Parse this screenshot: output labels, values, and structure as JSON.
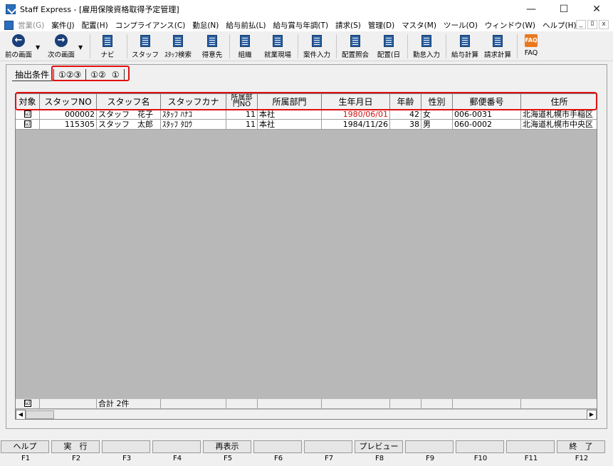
{
  "window": {
    "title": "Staff Express - [雇用保険資格取得予定管理]",
    "controls": [
      "—",
      "☐",
      "✕"
    ]
  },
  "menubar": {
    "items": [
      {
        "label": "営業(G)",
        "disabled": true
      },
      {
        "label": "案件(J)"
      },
      {
        "label": "配置(H)"
      },
      {
        "label": "コンプライアンス(C)"
      },
      {
        "label": "勤怠(N)"
      },
      {
        "label": "給与前払(L)"
      },
      {
        "label": "給与賞与年調(T)"
      },
      {
        "label": "請求(S)"
      },
      {
        "label": "管理(D)"
      },
      {
        "label": "マスタ(M)"
      },
      {
        "label": "ツール(O)"
      },
      {
        "label": "ウィンドウ(W)"
      },
      {
        "label": "ヘルプ(H)"
      }
    ],
    "mdi_controls": [
      "_",
      "ﾛ",
      "x"
    ]
  },
  "toolbar": {
    "prev": "前の画面",
    "next": "次の画面",
    "navi": "ナビ",
    "staff": "スタッフ",
    "staff_search": "ｽﾀｯﾌ検索",
    "client": "得意先",
    "org": "組織",
    "worksite": "就業現場",
    "case_input": "案件入力",
    "assign_inquiry": "配置照会",
    "assign_day": "配置(日",
    "attendance_input": "勤怠入力",
    "payroll_calc": "給与計算",
    "billing_calc": "請求計算",
    "faq": "FAQ",
    "faq_icon_text": "FAQ"
  },
  "tabs": {
    "items": [
      "抽出条件",
      "①②③",
      "①②",
      "①"
    ]
  },
  "grid": {
    "columns": [
      "対象",
      "スタッフNO",
      "スタッフ名",
      "スタッフカナ",
      "所属部門NO",
      "所属部門",
      "生年月日",
      "年齢",
      "性別",
      "郵便番号",
      "住所"
    ],
    "column_no_top": "所属部",
    "column_no_bottom": "門NO",
    "rows": [
      {
        "checked": "☑",
        "no": "000002",
        "name": "スタッフ　花子",
        "kana": "ｽﾀｯﾌ ﾊﾅｺ",
        "dept_no": "11",
        "dept": "本社",
        "dob": "1980/06/01",
        "age": "42",
        "gender": "女",
        "zip": "006-0031",
        "address": "北海道札幌市手稲区"
      },
      {
        "checked": "☑",
        "no": "115305",
        "name": "スタッフ　太郎",
        "kana": "ｽﾀｯﾌ ﾀﾛｳ",
        "dept_no": "11",
        "dept": "本社",
        "dob": "1984/11/26",
        "age": "38",
        "gender": "男",
        "zip": "060-0002",
        "address": "北海道札幌市中央区"
      }
    ],
    "total_check": "☑",
    "total_label": "合計 2件"
  },
  "fkeys": [
    {
      "label": "ヘルプ",
      "key": "F1"
    },
    {
      "label": "実　行",
      "key": "F2"
    },
    {
      "label": "",
      "key": "F3"
    },
    {
      "label": "",
      "key": "F4"
    },
    {
      "label": "再表示",
      "key": "F5"
    },
    {
      "label": "",
      "key": "F6"
    },
    {
      "label": "",
      "key": "F7"
    },
    {
      "label": "プレビュー",
      "key": "F8"
    },
    {
      "label": "",
      "key": "F9"
    },
    {
      "label": "",
      "key": "F10"
    },
    {
      "label": "",
      "key": "F11"
    },
    {
      "label": "終　了",
      "key": "F12"
    }
  ],
  "colors": {
    "highlight": "#e01010",
    "dob_red": "#d01010"
  }
}
